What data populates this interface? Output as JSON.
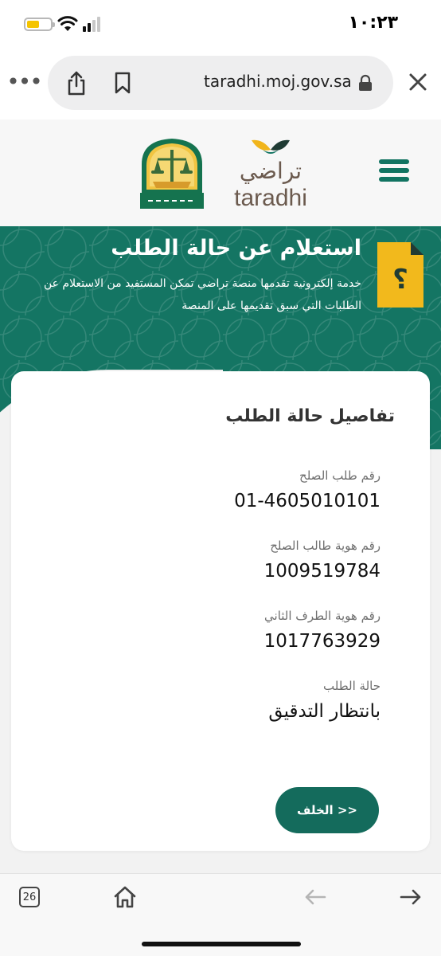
{
  "status_bar": {
    "time": "١٠:٢٣",
    "battery_level": 0.55,
    "battery_color": "#f5c400"
  },
  "browser": {
    "url": "taradhi.moj.gov.sa",
    "tab_count": "26"
  },
  "header": {
    "logo_arabic": "تراضي",
    "logo_english": "taradhi",
    "brand_color": "#127462"
  },
  "hero": {
    "title": "استعلام عن حالة الطلب",
    "description": "خدمة إلكترونية تقدمها منصة تراضي تمكن المستفيد من الاستعلام عن الطلبات التي سبق تقديمها على المنصة"
  },
  "card": {
    "title": "تفاصيل حالة الطلب",
    "fields": [
      {
        "label": "رقم طلب الصلح",
        "value": "01-4605010101"
      },
      {
        "label": "رقم هوية طالب الصلح",
        "value": "1009519784"
      },
      {
        "label": "رقم هوية الطرف الثاني",
        "value": "1017763929"
      },
      {
        "label": "حالة الطلب",
        "value": "بانتظار التدقيق"
      }
    ],
    "back_button_label": "<< الخلف"
  }
}
